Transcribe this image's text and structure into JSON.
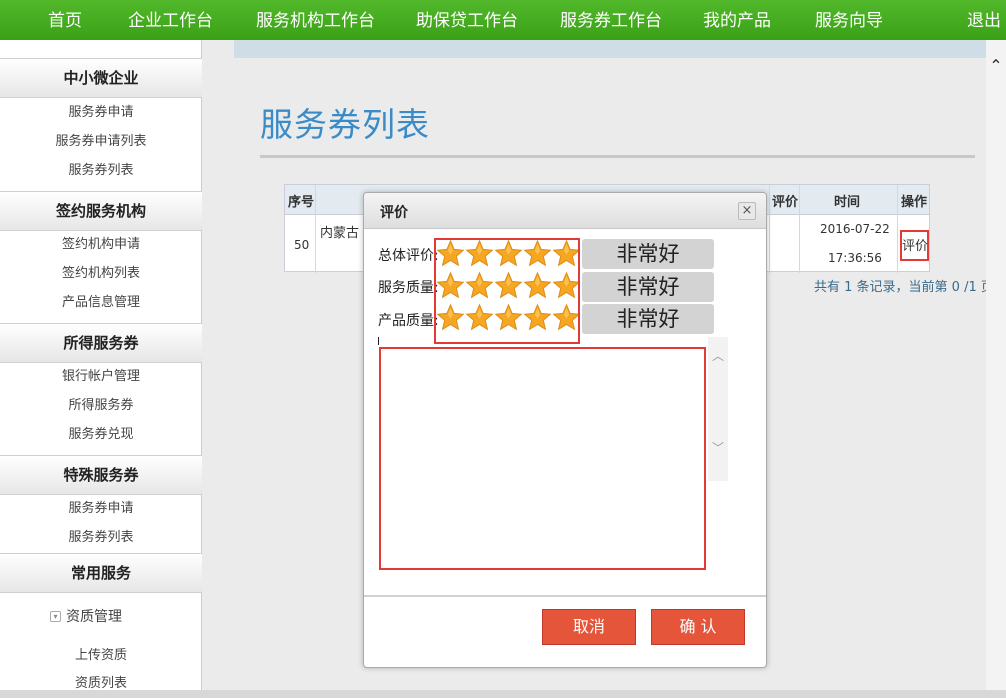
{
  "topnav": {
    "items": [
      "首页",
      "企业工作台",
      "服务机构工作台",
      "助保贷工作台",
      "服务券工作台",
      "我的产品",
      "服务向导",
      "退出"
    ]
  },
  "sidebar": {
    "sections": [
      {
        "title": "中小微企业",
        "links": [
          "服务券申请",
          "服务券申请列表",
          "服务券列表"
        ]
      },
      {
        "title": "签约服务机构",
        "links": [
          "签约机构申请",
          "签约机构列表",
          "产品信息管理"
        ]
      },
      {
        "title": "所得服务券",
        "links": [
          "银行帐户管理",
          "所得服务券",
          "服务券兑现"
        ]
      },
      {
        "title": "特殊服务券",
        "links": [
          "服务券申请",
          "服务券列表"
        ]
      },
      {
        "title": "常用服务",
        "tree_item": "资质管理",
        "links": [
          "上传资质",
          "资质列表"
        ]
      }
    ]
  },
  "main": {
    "title": "服务券列表",
    "table": {
      "headers": {
        "seq": "序号",
        "eval": "评价",
        "time": "时间",
        "op": "操作"
      },
      "row": {
        "seq": "50",
        "name": "内蒙古",
        "date": "2016-07-22",
        "clock": "17:36:56",
        "action": "评价"
      }
    },
    "pager": "共有 1 条记录，当前第 0 /1 页"
  },
  "modal": {
    "title": "评价",
    "close": "×",
    "ratings": [
      {
        "label": "总体评价:",
        "stars": 5,
        "text": "非常好"
      },
      {
        "label": "服务质量:",
        "stars": 5,
        "text": "非常好"
      },
      {
        "label": "产品质量:",
        "stars": 5,
        "text": "非常好"
      }
    ],
    "comment_value": "",
    "cancel": "取消",
    "confirm": "确 认"
  },
  "colors": {
    "nav_green": "#45aa20",
    "title_blue": "#3a8cc8",
    "button_red": "#e4553a",
    "highlight_red": "#e53935",
    "star_orange": "#f5a623"
  }
}
